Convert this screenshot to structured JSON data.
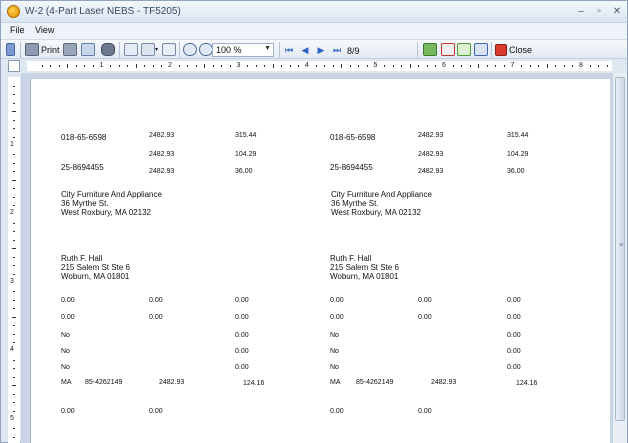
{
  "window": {
    "title": "W-2 (4-Part Laser NEBS - TF5205)",
    "minimize": "–",
    "restore": "▫",
    "close": "✕"
  },
  "menu": {
    "file": "File",
    "view": "View"
  },
  "toolbar": {
    "print_label": "Print",
    "zoom_value": "100 %",
    "page_indicator": "8/9",
    "close_label": "Close"
  },
  "ruler": {
    "h_numbers": [
      "1",
      "2",
      "3",
      "4",
      "5",
      "6",
      "7",
      "8"
    ],
    "v_numbers": [
      "1",
      "2",
      "3",
      "4",
      "5"
    ]
  },
  "left": {
    "ssn": "018-65-6598",
    "ein": "25-8694455",
    "wages": "2482.93",
    "fed_tax": "315.44",
    "ss_wages": "2482.93",
    "ss_tax": "104.29",
    "med_wages": "2482.93",
    "med_tax": "36.00",
    "employer": [
      "City Furniture And Appliance",
      "36 Myrthe St.",
      "West Roxbury, MA 02132"
    ],
    "employee": [
      "Ruth F. Hall",
      "215 Salem St Ste 6",
      "Woburn, MA 01801"
    ],
    "row1": [
      "0.00",
      "0.00",
      "0.00"
    ],
    "row2": [
      "0.00",
      "0.00",
      "0.00"
    ],
    "row3": [
      "No",
      "0.00"
    ],
    "row4": [
      "No",
      "0.00"
    ],
    "row5": [
      "No",
      "0.00"
    ],
    "state": [
      "MA",
      "85-4262149",
      "2482.93",
      "124.16"
    ],
    "row7": [
      "0.00",
      "0.00"
    ]
  },
  "right": {
    "ssn": "018-65-6598",
    "ein": "25-8694455",
    "wages": "2482.93",
    "fed_tax": "315.44",
    "ss_wages": "2482.93",
    "ss_tax": "104.29",
    "med_wages": "2482.93",
    "med_tax": "36.00",
    "employer": [
      "City Furniture And Appliance",
      "36 Myrthe St.",
      "West Roxbury, MA 02132"
    ],
    "employee": [
      "Ruth F. Hall",
      "215 Salem St Ste 6",
      "Woburn, MA 01801"
    ],
    "row1": [
      "0.00",
      "0.00",
      "0.00"
    ],
    "row2": [
      "0.00",
      "0.00",
      "0.00"
    ],
    "row3": [
      "No",
      "0.00"
    ],
    "row4": [
      "No",
      "0.00"
    ],
    "row5": [
      "No",
      "0.00"
    ],
    "state": [
      "MA",
      "85-4262149",
      "2482.93",
      "124.16"
    ],
    "row7": [
      "0.00",
      "0.00"
    ]
  }
}
